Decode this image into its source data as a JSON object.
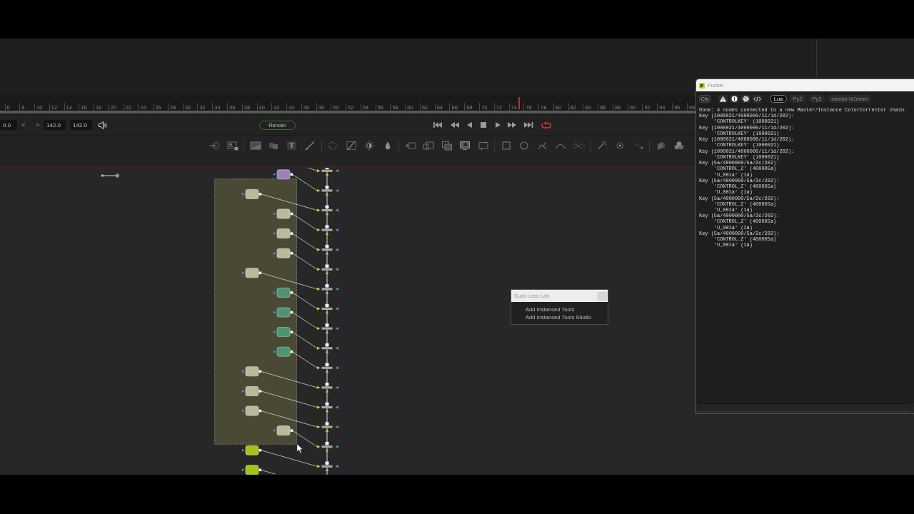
{
  "ruler": {
    "labels": [
      "6",
      "8",
      "10",
      "12",
      "14",
      "16",
      "18",
      "20",
      "22",
      "24",
      "26",
      "28",
      "30",
      "32",
      "34",
      "36",
      "38",
      "40",
      "42",
      "44",
      "46",
      "48",
      "50",
      "52",
      "54",
      "56",
      "58",
      "60",
      "62",
      "64",
      "66",
      "68",
      "70",
      "72",
      "74",
      "76",
      "78",
      "80",
      "82",
      "84",
      "86",
      "88",
      "90",
      "92",
      "94",
      "96",
      "98"
    ],
    "playhead": {
      "level": 0.745
    }
  },
  "transport": {
    "start_time": "0.0",
    "step_back": "<",
    "step_forward": ">",
    "current_time": "142.0",
    "end_time": "142.0",
    "render_button": "Render",
    "loop": {
      "on": true
    }
  },
  "toolbar": {
    "text_tool": "T"
  },
  "node_graph": {
    "nodes": [
      {
        "color": "#9e80bb"
      },
      {
        "color": "#bcb89c"
      },
      {
        "color": "#bcb89c"
      },
      {
        "color": "#bcb89c"
      },
      {
        "color": "#bcb89c"
      },
      {
        "color": "#bcb89c"
      },
      {
        "color": "#4f9471"
      },
      {
        "color": "#4f9471"
      },
      {
        "color": "#4f9471"
      },
      {
        "color": "#4f9471"
      },
      {
        "color": "#bcb89c"
      },
      {
        "color": "#bcb89c"
      },
      {
        "color": "#bcb89c"
      },
      {
        "color": "#bcb89c"
      },
      {
        "color": "#a4c21c"
      },
      {
        "color": "#a4c21c"
      }
    ]
  },
  "context_menu": {
    "title": "Suck Less Lab",
    "items": [
      "Add Instanced Tools",
      "Add Instanced Tools Studio"
    ]
  },
  "console": {
    "title": "Fusion",
    "clear_button": "Cls",
    "languages": [
      {
        "label": "Lua",
        "selected": true
      },
      {
        "label": "Py2",
        "selected": false
      },
      {
        "label": "Py3",
        "selected": false
      }
    ],
    "extra_button": "ımodoı hComm",
    "output": [
      {
        "text": "Done: 4 nodes connected to a new Master/Instance ColorCorrector chain."
      },
      {
        "text": "Key (1000021/4000000/11/1d/202):",
        "details": [
          "'CONTROLKEY' (1000021)"
        ]
      },
      {
        "text": "Key (1000021/4000000/11/1d/202):",
        "details": [
          "'CONTROLKEY' (1000021)"
        ]
      },
      {
        "text": "Key (1000021/4000000/11/1d/202):",
        "details": [
          "'CONTROLKEY' (1000021)"
        ]
      },
      {
        "text": "Key (1000021/4000000/11/1d/202):",
        "details": [
          "'CONTROLKEY' (1000021)"
        ]
      },
      {
        "text": "Key (5a/4000000/5a/2c/202):",
        "details": [
          "'CONTROL_Z' (400005a)",
          "'U_001a' (1a)"
        ]
      },
      {
        "text": "Key (5a/4000000/5a/2c/202):",
        "details": [
          "'CONTROL_Z' (400005a)",
          "'U_001a' (1a)"
        ]
      },
      {
        "text": "Key (5a/4000000/5a/2c/202):",
        "details": [
          "'CONTROL_Z' (400005a)",
          "'U_001a' (1a)"
        ]
      },
      {
        "text": "Key (5a/4000000/5a/2c/202):",
        "details": [
          "'CONTROL_Z' (400005a)",
          "'U_001a' (1a)"
        ]
      },
      {
        "text": "Key (5a/4000000/5a/2c/202):",
        "details": [
          "'CONTROL_Z' (400005a)",
          "'U_001a' (1a)"
        ]
      }
    ]
  }
}
